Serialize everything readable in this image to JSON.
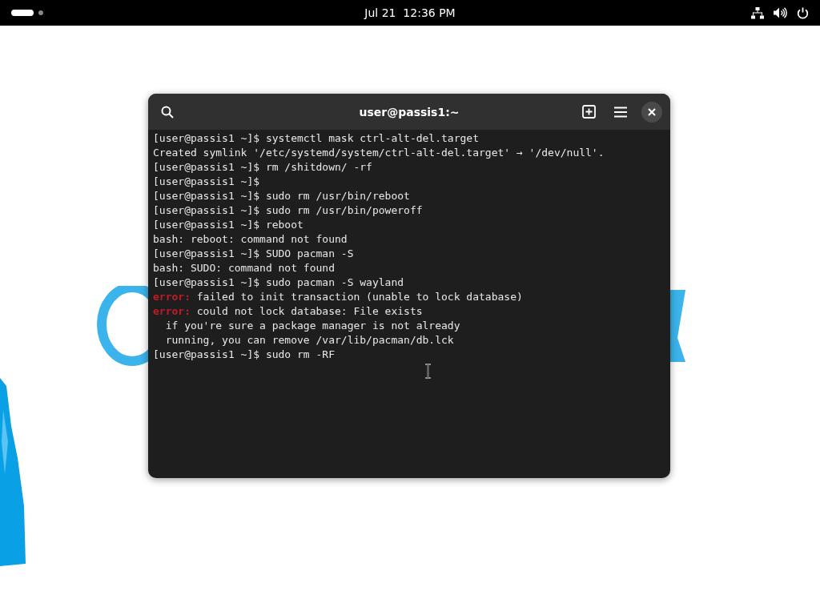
{
  "top_bar": {
    "clock": "Jul 21  12:36 PM",
    "workspaces": [
      {
        "selected": true
      },
      {
        "selected": false
      }
    ]
  },
  "window": {
    "title": "user@passis1:~"
  },
  "terminal": {
    "lines": [
      {
        "kind": "prompt",
        "prompt": "[user@passis1 ~]$",
        "text": "systemctl mask ctrl-alt-del.target"
      },
      {
        "kind": "output",
        "text": "Created symlink '/etc/systemd/system/ctrl-alt-del.target' → '/dev/null'."
      },
      {
        "kind": "prompt",
        "prompt": "[user@passis1 ~]$",
        "text": "rm /shitdown/ -rf"
      },
      {
        "kind": "prompt",
        "prompt": "[user@passis1 ~]$"
      },
      {
        "kind": "prompt",
        "prompt": "[user@passis1 ~]$",
        "text": "sudo rm /usr/bin/reboot"
      },
      {
        "kind": "prompt",
        "prompt": "[user@passis1 ~]$",
        "text": "sudo rm /usr/bin/poweroff"
      },
      {
        "kind": "prompt",
        "prompt": "[user@passis1 ~]$",
        "text": "reboot"
      },
      {
        "kind": "output",
        "text": "bash: reboot: command not found"
      },
      {
        "kind": "prompt",
        "prompt": "[user@passis1 ~]$",
        "text": "SUDO pacman -S"
      },
      {
        "kind": "output",
        "text": "bash: SUDO: command not found"
      },
      {
        "kind": "prompt",
        "prompt": "[user@passis1 ~]$",
        "text": "sudo pacman -S wayland"
      },
      {
        "kind": "error",
        "prefix": "error:",
        "text": "failed to init transaction (unable to lock database)"
      },
      {
        "kind": "error",
        "prefix": "error:",
        "text": "could not lock database: File exists"
      },
      {
        "kind": "output",
        "text": "  if you're sure a package manager is not already"
      },
      {
        "kind": "output",
        "text": "  running, you can remove /var/lib/pacman/db.lck"
      },
      {
        "kind": "prompt",
        "prompt": "[user@passis1 ~]$",
        "text": "sudo rm -RF"
      }
    ]
  }
}
